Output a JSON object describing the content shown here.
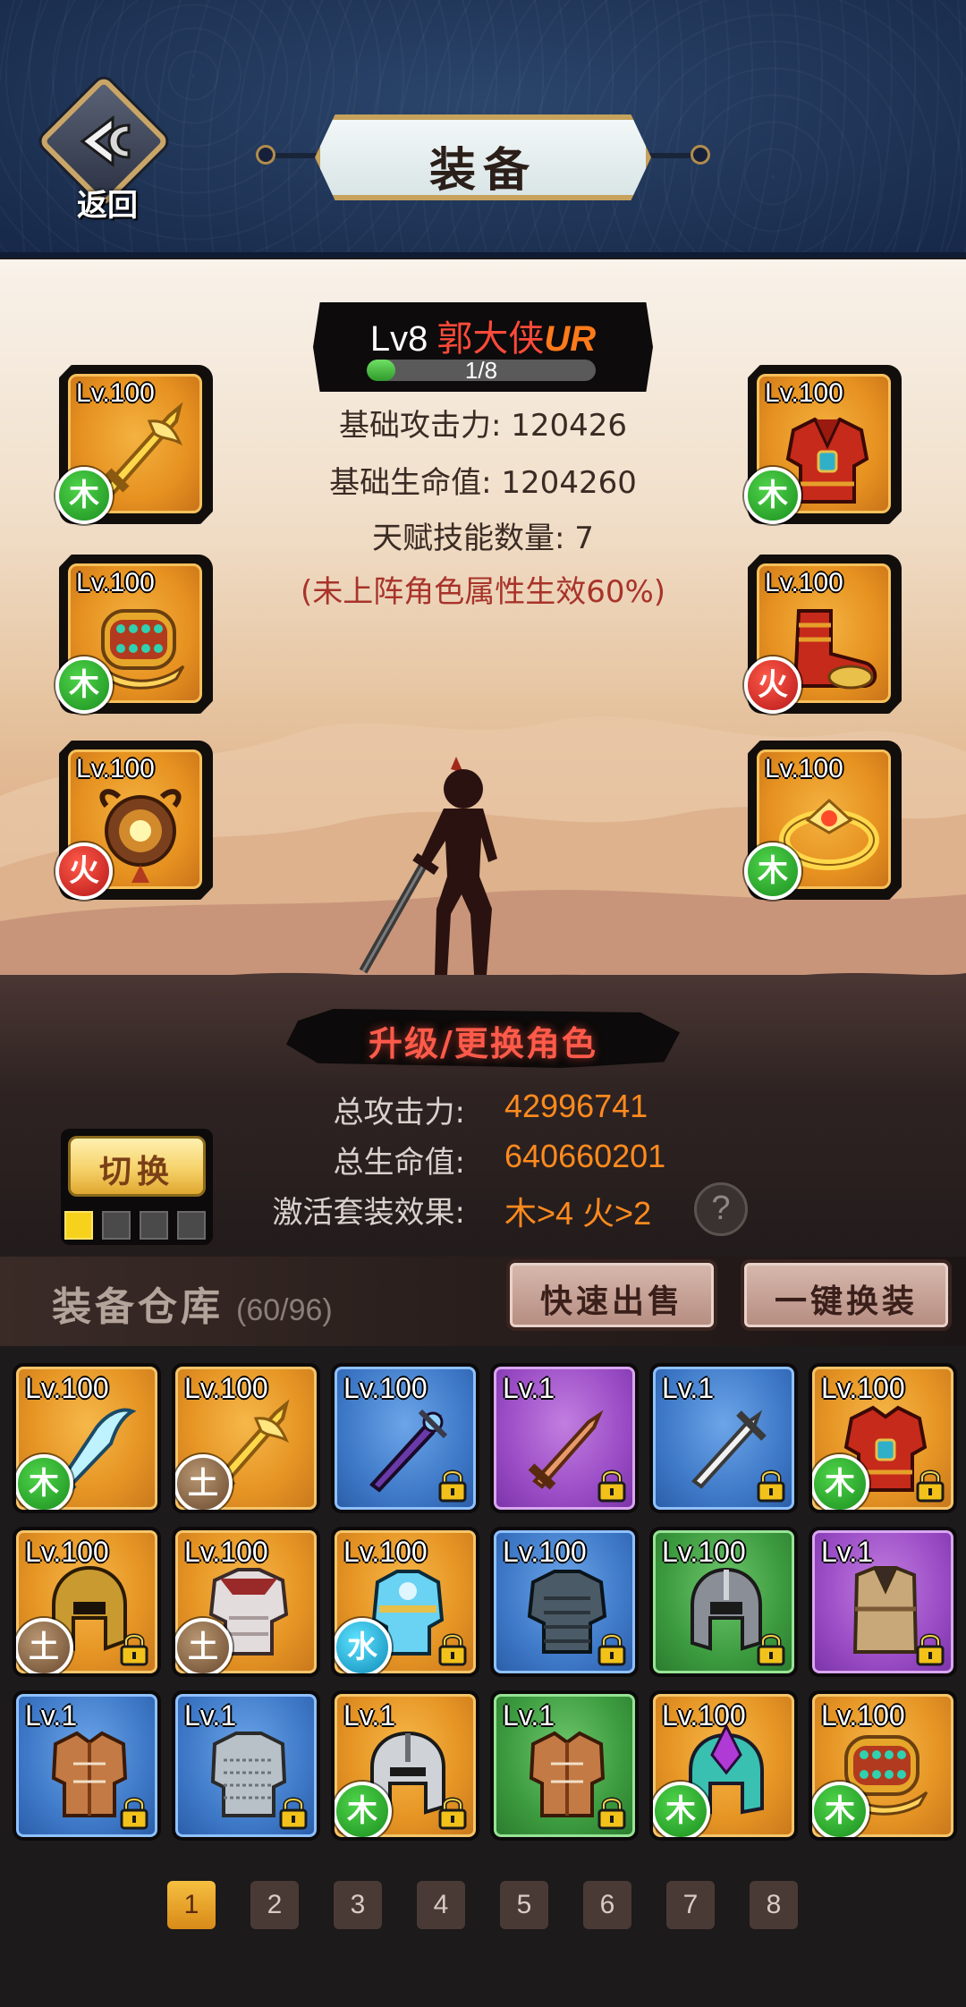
{
  "header": {
    "back_label": "返回",
    "title": "装备"
  },
  "hero": {
    "level": "Lv8",
    "name": "郭大侠",
    "rarity": "UR",
    "exp_text": "1/8",
    "exp_fraction": 0.125,
    "stats": {
      "attack": "基础攻击力: 120426",
      "hp": "基础生命值: 1204260",
      "talents": "天赋技能数量: 7",
      "note": "(未上阵角色属性生效60%)"
    }
  },
  "equipped": {
    "left": [
      {
        "level": "Lv.100",
        "element": "木",
        "element_type": "wood",
        "item": "golden-sword-icon"
      },
      {
        "level": "Lv.100",
        "element": "木",
        "element_type": "wood",
        "item": "golden-bracer-icon"
      },
      {
        "level": "Lv.100",
        "element": "火",
        "element_type": "fire",
        "item": "amulet-icon"
      }
    ],
    "right": [
      {
        "level": "Lv.100",
        "element": "木",
        "element_type": "wood",
        "item": "red-armor-icon"
      },
      {
        "level": "Lv.100",
        "element": "火",
        "element_type": "fire",
        "item": "red-boots-icon"
      },
      {
        "level": "Lv.100",
        "element": "木",
        "element_type": "wood",
        "item": "golden-ring-icon"
      }
    ]
  },
  "upgrade_label": "升级/更换角色",
  "totals": {
    "attack_label": "总攻击力:",
    "attack_value": "42996741",
    "hp_label": "总生命值:",
    "hp_value": "640660201",
    "set_label": "激活套装效果:",
    "set_value": "木>4  火>2",
    "help": "?"
  },
  "switch": {
    "label": "切换",
    "active_index": 0,
    "count": 4
  },
  "warehouse": {
    "title": "装备仓库",
    "count": "(60/96)",
    "quick_sell": "快速出售",
    "auto_equip": "一键换装"
  },
  "inventory": [
    {
      "level": "Lv.100",
      "rarity": "gold",
      "element": "木",
      "element_type": "wood",
      "item": "ice-blade-icon",
      "locked": false
    },
    {
      "level": "Lv.100",
      "rarity": "gold",
      "element": "土",
      "element_type": "earth",
      "item": "golden-sword-icon",
      "locked": false
    },
    {
      "level": "Lv.100",
      "rarity": "blue",
      "element": "",
      "element_type": "",
      "item": "dark-sword-icon",
      "locked": true
    },
    {
      "level": "Lv.1",
      "rarity": "purple",
      "element": "",
      "element_type": "",
      "item": "bronze-sword-icon",
      "locked": true
    },
    {
      "level": "Lv.1",
      "rarity": "blue",
      "element": "",
      "element_type": "",
      "item": "steel-sword-icon",
      "locked": true
    },
    {
      "level": "Lv.100",
      "rarity": "gold",
      "element": "木",
      "element_type": "wood",
      "item": "red-armor-icon",
      "locked": true
    },
    {
      "level": "Lv.100",
      "rarity": "gold",
      "element": "土",
      "element_type": "earth",
      "item": "gold-helmet-icon",
      "locked": true
    },
    {
      "level": "Lv.100",
      "rarity": "gold",
      "element": "土",
      "element_type": "earth",
      "item": "plate-armor-icon",
      "locked": false
    },
    {
      "level": "Lv.100",
      "rarity": "gold",
      "element": "水",
      "element_type": "water",
      "item": "ice-armor-icon",
      "locked": true
    },
    {
      "level": "Lv.100",
      "rarity": "blue",
      "element": "",
      "element_type": "",
      "item": "scale-armor-icon",
      "locked": true
    },
    {
      "level": "Lv.100",
      "rarity": "green",
      "element": "",
      "element_type": "",
      "item": "iron-helmet-icon",
      "locked": true
    },
    {
      "level": "Lv.1",
      "rarity": "purple",
      "element": "",
      "element_type": "",
      "item": "leather-vest-icon",
      "locked": true
    },
    {
      "level": "Lv.1",
      "rarity": "blue",
      "element": "",
      "element_type": "",
      "item": "leather-armor-icon",
      "locked": true
    },
    {
      "level": "Lv.1",
      "rarity": "blue",
      "element": "",
      "element_type": "",
      "item": "chainmail-icon",
      "locked": true
    },
    {
      "level": "Lv.1",
      "rarity": "gold",
      "element": "木",
      "element_type": "wood",
      "item": "knight-helmet-icon",
      "locked": true
    },
    {
      "level": "Lv.1",
      "rarity": "green",
      "element": "",
      "element_type": "",
      "item": "leather-armor-icon",
      "locked": true
    },
    {
      "level": "Lv.100",
      "rarity": "gold",
      "element": "木",
      "element_type": "wood",
      "item": "purple-helmet-icon",
      "locked": false
    },
    {
      "level": "Lv.100",
      "rarity": "gold",
      "element": "木",
      "element_type": "wood",
      "item": "golden-bracer-icon",
      "locked": false
    }
  ],
  "pager": {
    "pages": [
      "1",
      "2",
      "3",
      "4",
      "5",
      "6",
      "7",
      "8"
    ],
    "current": "1"
  },
  "colors": {
    "header_bg": "#1f3456",
    "accent_gold": "#c7a25c",
    "value_orange": "#ff8a1e",
    "hero_name_red": "#ff4a3a",
    "note_red": "#a8332a"
  }
}
